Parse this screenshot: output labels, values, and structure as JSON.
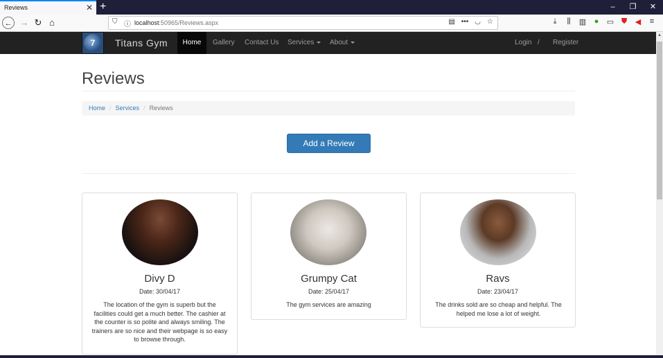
{
  "browser": {
    "tab_title": "Reviews",
    "tab_close": "✕",
    "new_tab": "+",
    "url_host": "localhost",
    "url_rest": ":50965/Reviews.aspx",
    "win_min": "–",
    "win_restore": "❐",
    "win_close": "✕"
  },
  "navbar": {
    "brand": "Titans Gym",
    "logo_text": "7",
    "items": [
      {
        "label": "Home",
        "active": true
      },
      {
        "label": "Gallery"
      },
      {
        "label": "Contact Us"
      },
      {
        "label": "Services",
        "dropdown": true
      },
      {
        "label": "About",
        "dropdown": true
      }
    ],
    "login": "Login",
    "separator": "/",
    "register": "Register"
  },
  "page": {
    "title": "Reviews",
    "breadcrumb": [
      "Home",
      "Services",
      "Reviews"
    ],
    "breadcrumb_sep": "/",
    "add_review_label": "Add a Review"
  },
  "reviews": [
    {
      "name": "Divy D",
      "date": "Date: 30/04/17",
      "text": "The location of the gym is superb but the facilities could get a much better. The cashier at the counter is so polite and always smiling. The trainers are so nice and their webpage is so easy to browse through.",
      "avatar_icon": "person-photo-icon"
    },
    {
      "name": "Grumpy Cat",
      "date": "Date: 25/04/17",
      "text": "The gym services are amazing",
      "avatar_icon": "cat-photo-icon"
    },
    {
      "name": "Ravs",
      "date": "Date: 23/04/17",
      "text": "The drinks sold are so cheap and helpful. The helped me lose a lot of weight.",
      "avatar_icon": "person-photo-icon"
    }
  ],
  "colors": {
    "navbar_bg": "#222222",
    "primary": "#337ab7",
    "link": "#337ab7"
  }
}
